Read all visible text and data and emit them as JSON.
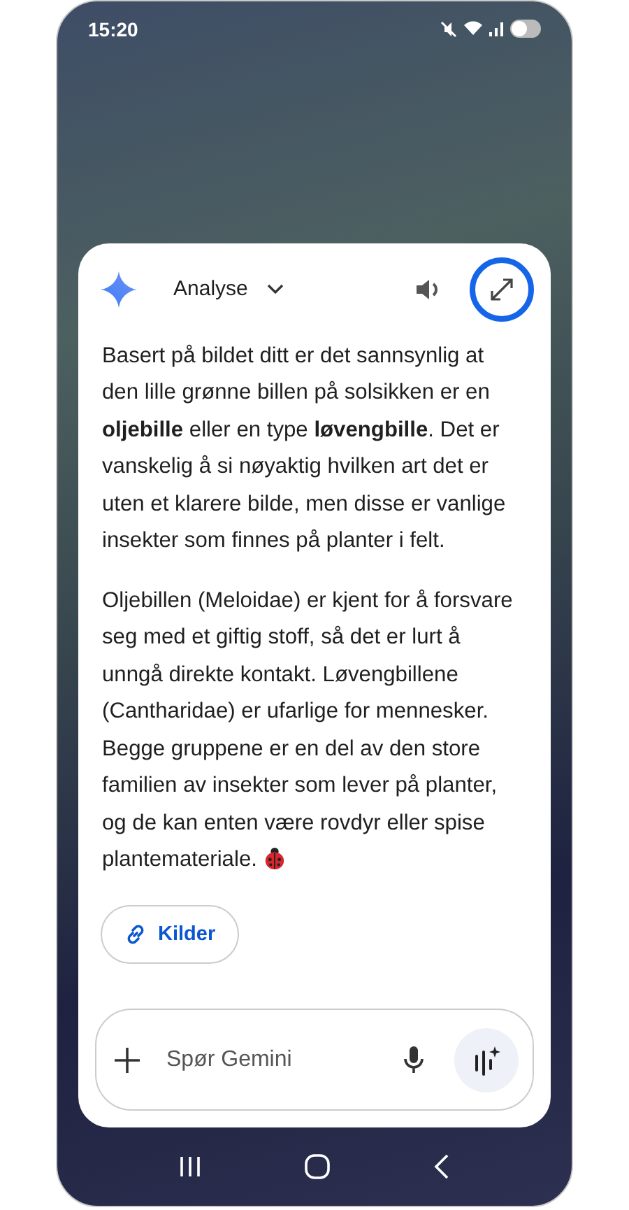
{
  "status_bar": {
    "time": "15:20",
    "toggle_on": false
  },
  "header": {
    "mode": "Analyse",
    "expand_highlighted": true
  },
  "paragraphs": [
    "Basert på bildet ditt er det sannsynlig at den lille grønne billen på solsikken er en **oljebille** eller en type **løvengbille**. Det er vanskelig å si nøyaktig hvilken art det er uten et klarere bilde, men disse er vanlige insekter som finnes på planter i felt.",
    "Oljebillen (Meloidae) er kjent for å forsvare seg med et giftig stoff, så det er lurt å unngå direkte kontakt. Løvengbillene (Cantharidae) er ufarlige for mennesker. Begge gruppene er en del av den store familien av insekter som lever på planter, og de kan enten være rovdyr eller spise plantemateriale."
  ],
  "sources_button": "Kilder",
  "input": {
    "placeholder": "Spør Gemini"
  }
}
